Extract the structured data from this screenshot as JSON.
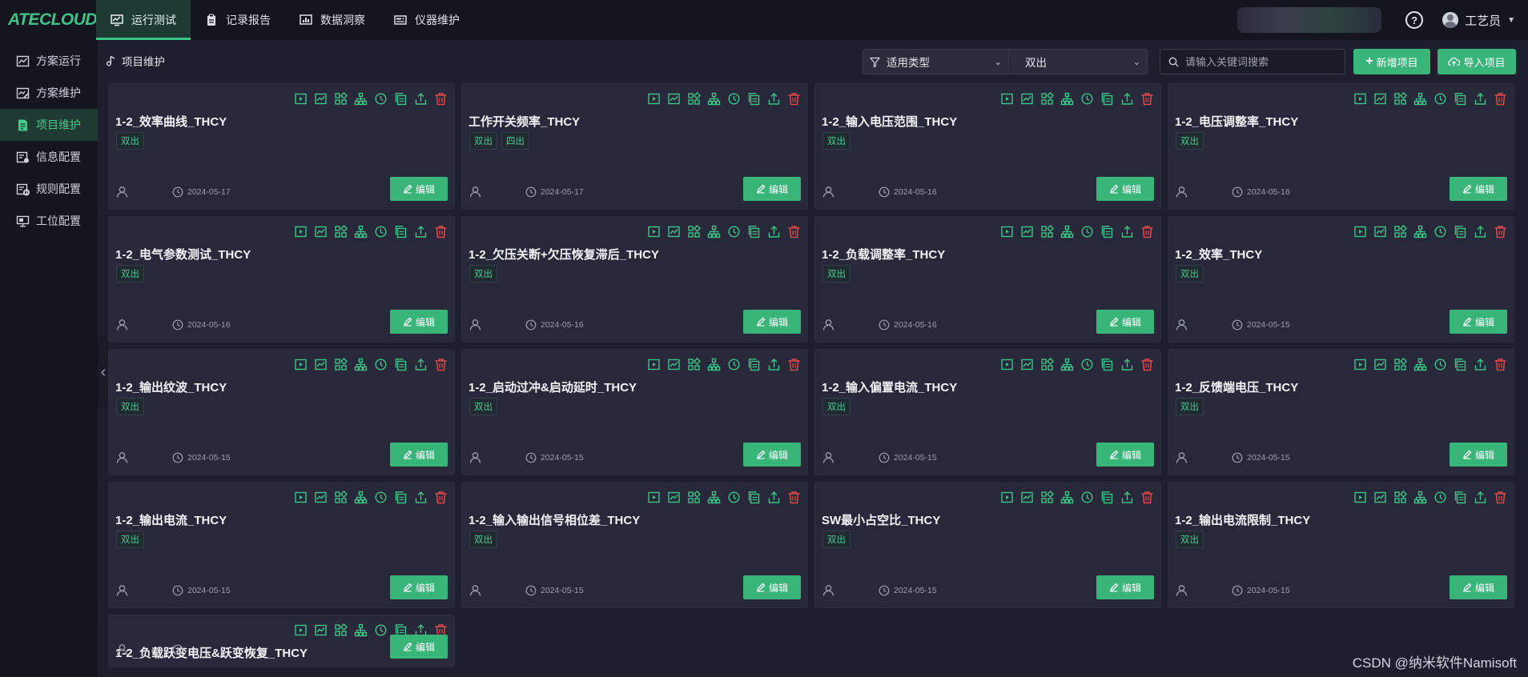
{
  "app": {
    "logo": "ATECLOUD"
  },
  "nav": {
    "tabs": [
      {
        "label": "运行测试",
        "active": true
      },
      {
        "label": "记录报告",
        "active": false
      },
      {
        "label": "数据洞察",
        "active": false
      },
      {
        "label": "仪器维护",
        "active": false
      }
    ]
  },
  "header": {
    "help": "?",
    "user_name": "工艺员"
  },
  "sidebar": {
    "items": [
      {
        "label": "方案运行",
        "active": false
      },
      {
        "label": "方案维护",
        "active": false
      },
      {
        "label": "项目维护",
        "active": true
      },
      {
        "label": "信息配置",
        "active": false
      },
      {
        "label": "规则配置",
        "active": false
      },
      {
        "label": "工位配置",
        "active": false
      }
    ]
  },
  "toolbar": {
    "breadcrumb": "项目维护",
    "filter_label": "适用类型",
    "filter_value": "双出",
    "search_placeholder": "请输入关键词搜索",
    "add_label": "新增项目",
    "import_label": "导入项目"
  },
  "card_edit_label": "编辑",
  "card_icons": [
    "run-icon",
    "chart-icon",
    "grid-icon",
    "hierarchy-icon",
    "history-icon",
    "copy-icon",
    "export-icon",
    "delete-icon"
  ],
  "colors": {
    "accent": "#3ab57a",
    "danger": "#e04848",
    "card": "#27283a",
    "background": "#1e1f2e"
  },
  "cards": [
    {
      "title": "1-2_效率曲线_THCY",
      "tags": [
        "双出"
      ],
      "date": "2024-05-17"
    },
    {
      "title": "工作开关频率_THCY",
      "tags": [
        "双出",
        "四出"
      ],
      "date": "2024-05-17"
    },
    {
      "title": "1-2_输入电压范围_THCY",
      "tags": [
        "双出"
      ],
      "date": "2024-05-16"
    },
    {
      "title": "1-2_电压调整率_THCY",
      "tags": [
        "双出"
      ],
      "date": "2024-05-16"
    },
    {
      "title": "1-2_电气参数测试_THCY",
      "tags": [
        "双出"
      ],
      "date": "2024-05-16"
    },
    {
      "title": "1-2_欠压关断+欠压恢复滞后_THCY",
      "tags": [
        "双出"
      ],
      "date": "2024-05-16"
    },
    {
      "title": "1-2_负载调整率_THCY",
      "tags": [
        "双出"
      ],
      "date": "2024-05-16"
    },
    {
      "title": "1-2_效率_THCY",
      "tags": [
        "双出"
      ],
      "date": "2024-05-15"
    },
    {
      "title": "1-2_输出纹波_THCY",
      "tags": [
        "双出"
      ],
      "date": "2024-05-15"
    },
    {
      "title": "1-2_启动过冲&启动延时_THCY",
      "tags": [
        "双出"
      ],
      "date": "2024-05-15"
    },
    {
      "title": "1-2_输入偏置电流_THCY",
      "tags": [
        "双出"
      ],
      "date": "2024-05-15"
    },
    {
      "title": "1-2_反馈端电压_THCY",
      "tags": [
        "双出"
      ],
      "date": "2024-05-15"
    },
    {
      "title": "1-2_输出电流_THCY",
      "tags": [
        "双出"
      ],
      "date": "2024-05-15"
    },
    {
      "title": "1-2_输入输出信号相位差_THCY",
      "tags": [
        "双出"
      ],
      "date": "2024-05-15"
    },
    {
      "title": "SW最小占空比_THCY",
      "tags": [
        "双出"
      ],
      "date": "2024-05-15"
    },
    {
      "title": "1-2_输出电流限制_THCY",
      "tags": [
        "双出"
      ],
      "date": "2024-05-15"
    },
    {
      "title": "1-2_负载跃变电压&跃变恢复_THCY",
      "tags": [],
      "date": ""
    }
  ],
  "watermark": "CSDN @纳米软件Namisoft"
}
